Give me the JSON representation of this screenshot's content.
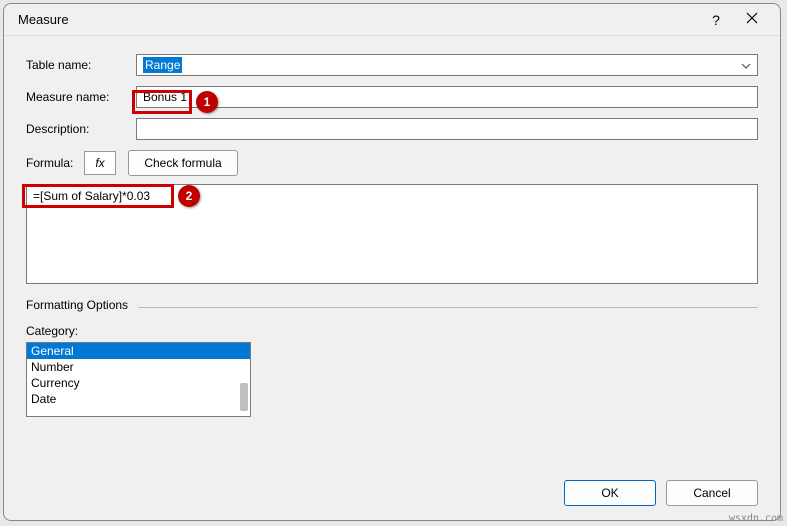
{
  "dialog": {
    "title": "Measure",
    "help_symbol": "?",
    "labels": {
      "table_name": "Table name:",
      "measure_name": "Measure name:",
      "description": "Description:",
      "formula_label": "Formula:",
      "fx": "fx",
      "check_formula": "Check formula",
      "formatting_options": "Formatting Options",
      "category": "Category:"
    },
    "values": {
      "table_name": "Range",
      "measure_name": "Bonus 1",
      "description": "",
      "formula": "=[Sum of Salary]*0.03"
    },
    "category_items": [
      "General",
      "Number",
      "Currency",
      "Date"
    ],
    "category_selected_index": 0,
    "buttons": {
      "ok": "OK",
      "cancel": "Cancel"
    }
  },
  "annotations": {
    "callout1": "1",
    "callout2": "2"
  },
  "watermark": "wsxdn.com"
}
